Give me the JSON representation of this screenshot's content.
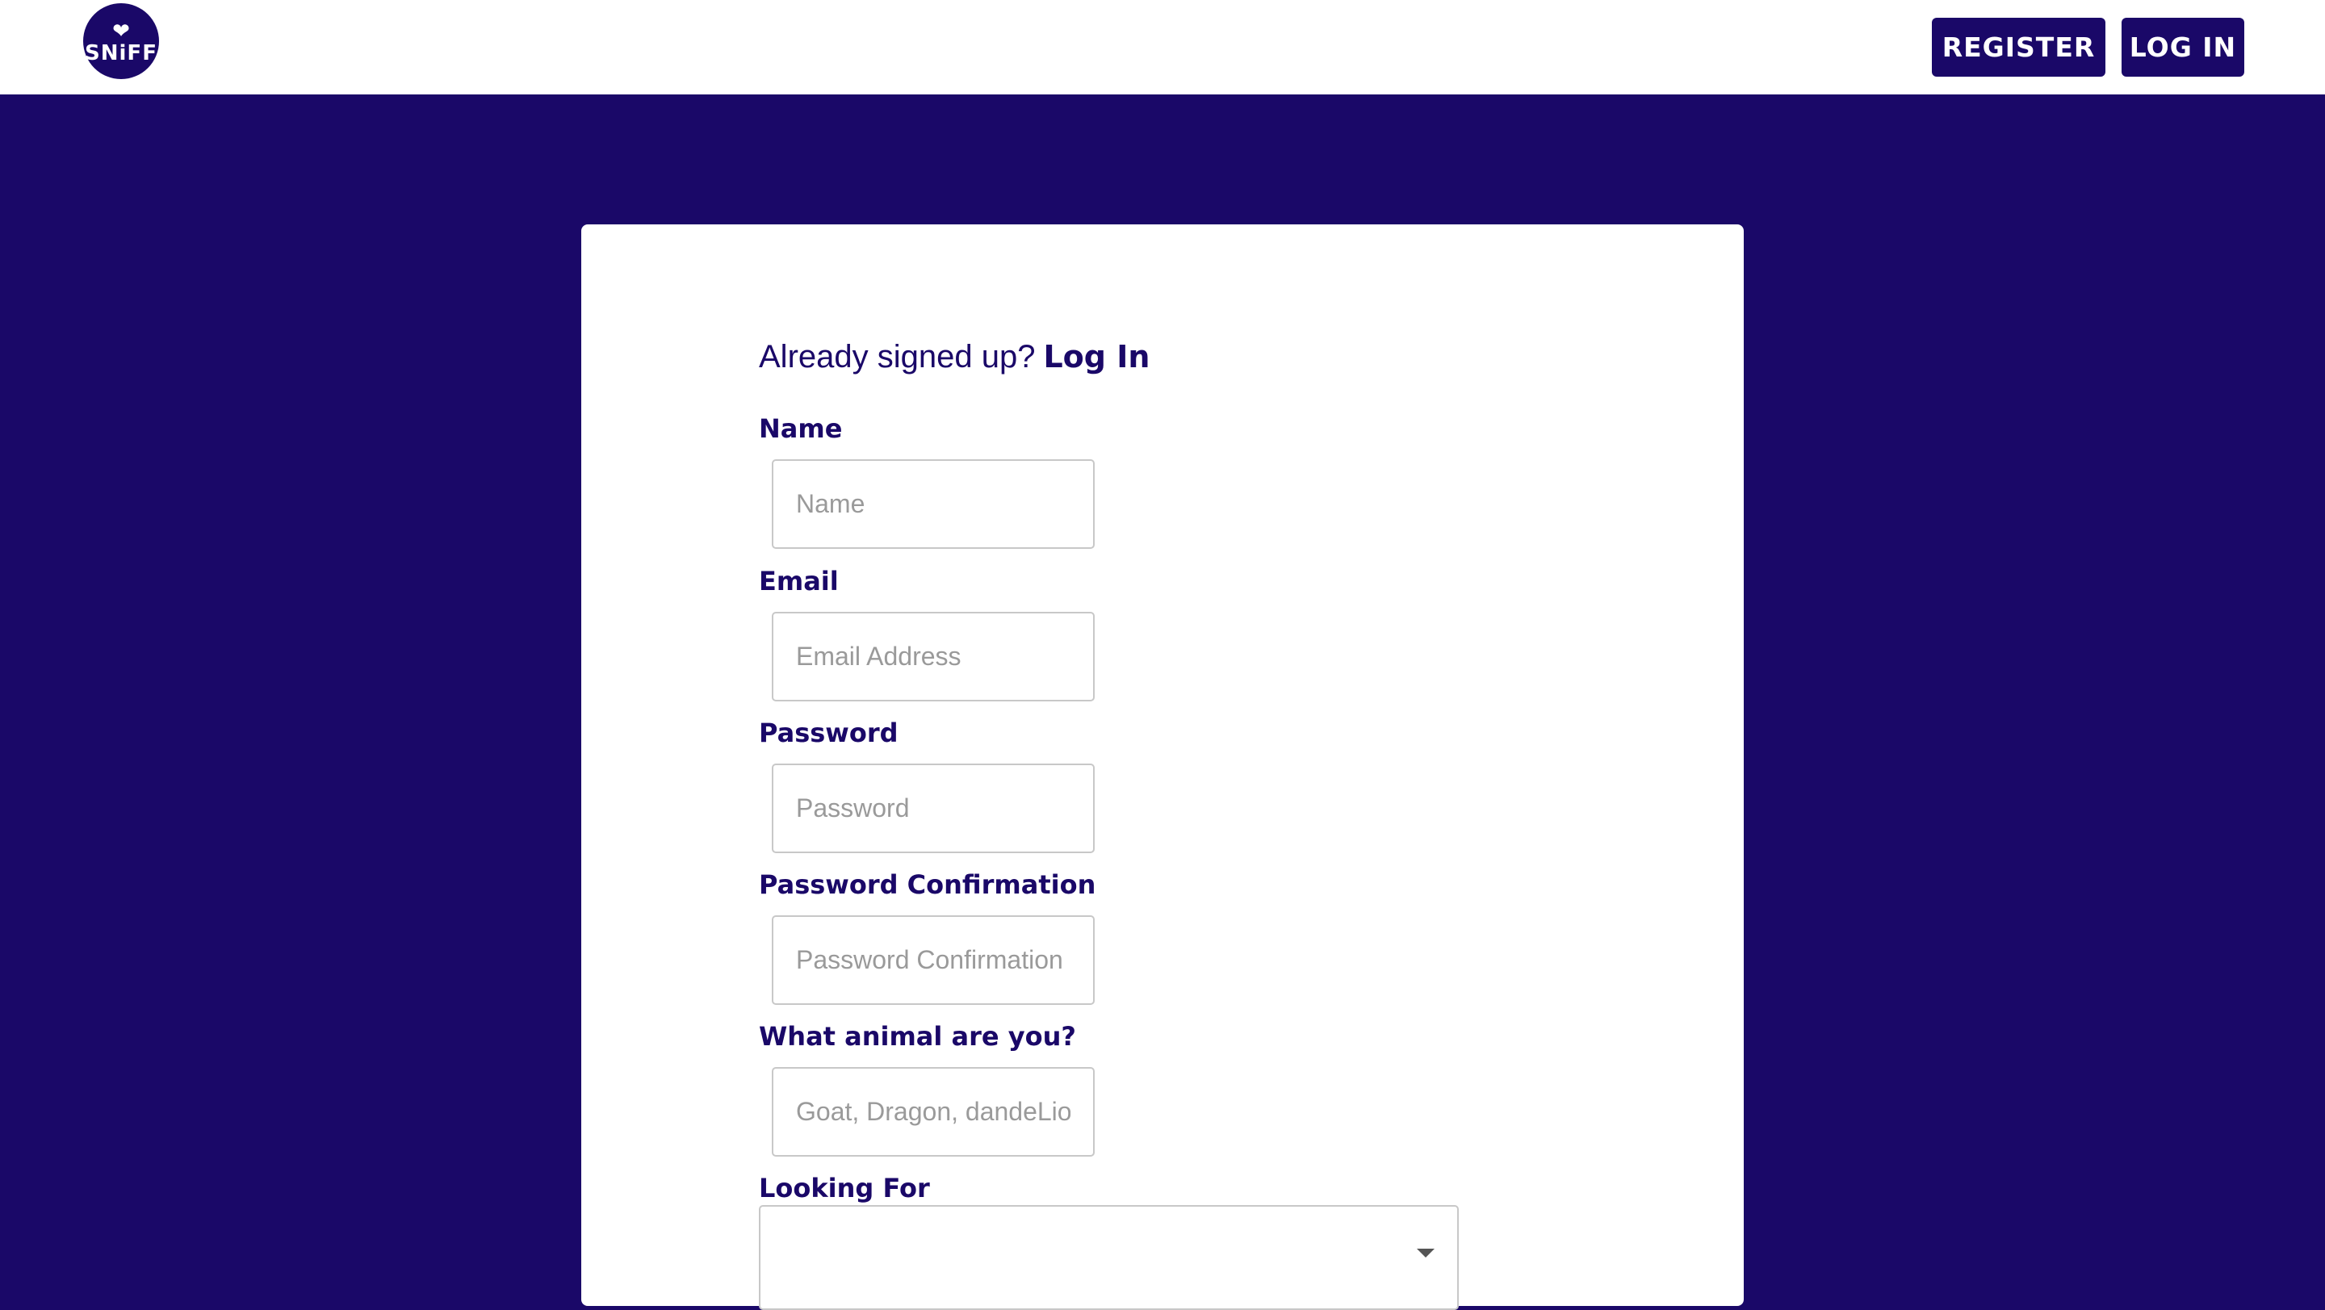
{
  "brand": {
    "logo_text": "SNiFF"
  },
  "nav": {
    "register_label": "REGISTER",
    "login_label": "LOG IN"
  },
  "form": {
    "prompt": "Already signed up?",
    "login_link": "Log In",
    "fields": [
      {
        "label": "Name",
        "placeholder": "Name",
        "value": ""
      },
      {
        "label": "Email",
        "placeholder": "Email Address",
        "value": ""
      },
      {
        "label": "Password",
        "placeholder": "Password",
        "value": ""
      },
      {
        "label": "Password Confirmation",
        "placeholder": "Password Confirmation",
        "value": ""
      },
      {
        "label": "What animal are you?",
        "placeholder": "Goat, Dragon, dandeLion",
        "value": ""
      }
    ],
    "looking_for": {
      "label": "Looking For",
      "selected": ""
    }
  },
  "colors": {
    "brand": "#1a0868",
    "card": "#ffffff",
    "input_border": "#c8c8c8",
    "placeholder": "#9a9a9a"
  },
  "icons": [
    "heart-paw-icon",
    "chevron-down-icon"
  ]
}
